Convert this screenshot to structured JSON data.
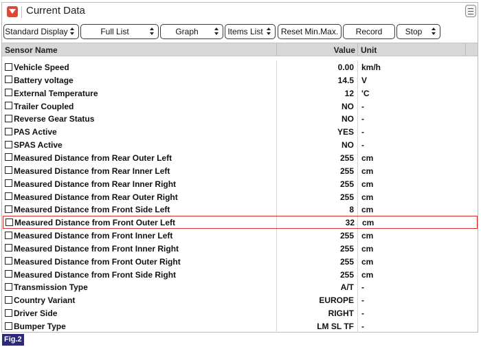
{
  "window": {
    "title": "Current Data"
  },
  "toolbar": {
    "standard_display": "Standard Display",
    "full_list": "Full List",
    "graph": "Graph",
    "items_list": "Items List",
    "reset": "Reset Min.Max.",
    "record": "Record",
    "stop": "Stop"
  },
  "table": {
    "headers": {
      "name": "Sensor Name",
      "value": "Value",
      "unit": "Unit"
    },
    "rows": [
      {
        "name": "Vehicle Speed",
        "value": "0.00",
        "unit": "km/h"
      },
      {
        "name": "Battery voltage",
        "value": "14.5",
        "unit": "V"
      },
      {
        "name": "External Temperature",
        "value": "12",
        "unit": "'C"
      },
      {
        "name": "Trailer Coupled",
        "value": "NO",
        "unit": "-"
      },
      {
        "name": "Reverse Gear Status",
        "value": "NO",
        "unit": "-"
      },
      {
        "name": "PAS Active",
        "value": "YES",
        "unit": "-"
      },
      {
        "name": "SPAS Active",
        "value": "NO",
        "unit": "-"
      },
      {
        "name": "Measured Distance from Rear Outer Left",
        "value": "255",
        "unit": "cm"
      },
      {
        "name": "Measured Distance from Rear Inner Left",
        "value": "255",
        "unit": "cm"
      },
      {
        "name": "Measured Distance from Rear Inner Right",
        "value": "255",
        "unit": "cm"
      },
      {
        "name": "Measured Distance from Rear Outer Right",
        "value": "255",
        "unit": "cm"
      },
      {
        "name": "Measured Distance from Front Side Left",
        "value": "8",
        "unit": "cm"
      },
      {
        "name": "Measured Distance from Front Outer Left",
        "value": "32",
        "unit": "cm",
        "selected": true
      },
      {
        "name": "Measured Distance from Front Inner Left",
        "value": "255",
        "unit": "cm"
      },
      {
        "name": "Measured Distance from Front Inner Right",
        "value": "255",
        "unit": "cm"
      },
      {
        "name": "Measured Distance from Front Outer Right",
        "value": "255",
        "unit": "cm"
      },
      {
        "name": "Measured Distance from Front Side Right",
        "value": "255",
        "unit": "cm"
      },
      {
        "name": "Transmission Type",
        "value": "A/T",
        "unit": "-"
      },
      {
        "name": "Country Variant",
        "value": "EUROPE",
        "unit": "-"
      },
      {
        "name": "Driver Side",
        "value": "RIGHT",
        "unit": "-"
      },
      {
        "name": "Bumper Type",
        "value": "LM SL TF",
        "unit": "-"
      }
    ]
  },
  "figure_label": "Fig.2",
  "colors": {
    "accent": "#d94a38",
    "selection": "#d8302a",
    "header_bg": "#d8d8d8",
    "fig_label_bg": "#2e2a7a"
  }
}
